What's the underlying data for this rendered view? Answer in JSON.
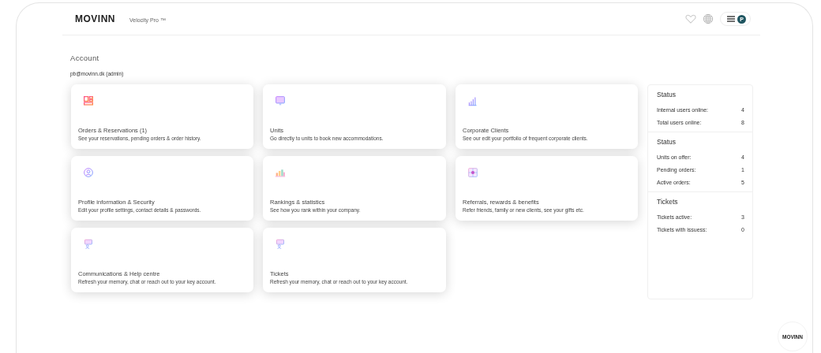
{
  "header": {
    "logo": "MOVINN",
    "product": "Velocity Pro ™",
    "avatar_letter": "P"
  },
  "account": {
    "title": "Account",
    "user": "pb@movinn.dk (admin)"
  },
  "cards": [
    {
      "kind": "orders",
      "title": "Orders & Reservations (1)",
      "description": "See your reservations, pending orders & order history."
    },
    {
      "kind": "units",
      "title": "Units",
      "description": "Go directly to units to book new accommodations."
    },
    {
      "kind": "clients",
      "title": "Corporate Clients",
      "description": "See our edit your portfolio of frequent corporate clients."
    },
    {
      "kind": "profile",
      "title": "Profile information & Security",
      "description": "Edit your profile settings, contact details & passwords."
    },
    {
      "kind": "rankings",
      "title": "Rankings & statistics",
      "description": "See how you rank within your company."
    },
    {
      "kind": "referrals",
      "title": "Referrals, rewards & benefits",
      "description": "Refer friends, family or new clients, see your gifts etc."
    },
    {
      "kind": "support",
      "title": "Communications & Help centre",
      "description": "Refresh your memory, chat or reach out to your key account."
    },
    {
      "kind": "support",
      "title": "Tickets",
      "description": "Refresh your memory, chat or reach out to your key account."
    }
  ],
  "status_panel": [
    {
      "title": "Status",
      "rows": [
        {
          "label": "Internal users online:",
          "value": "4"
        },
        {
          "label": "Total users online:",
          "value": "8"
        }
      ]
    },
    {
      "title": "Status",
      "rows": [
        {
          "label": "Units on offer:",
          "value": "4"
        },
        {
          "label": "Pending orders:",
          "value": "1"
        },
        {
          "label": "Active orders:",
          "value": "5"
        }
      ]
    },
    {
      "title": "Tickets",
      "rows": [
        {
          "label": "Tickets active:",
          "value": "3"
        },
        {
          "label": "Tickets with issuess:",
          "value": "0"
        }
      ]
    }
  ],
  "footer_badge": "MOVINN"
}
